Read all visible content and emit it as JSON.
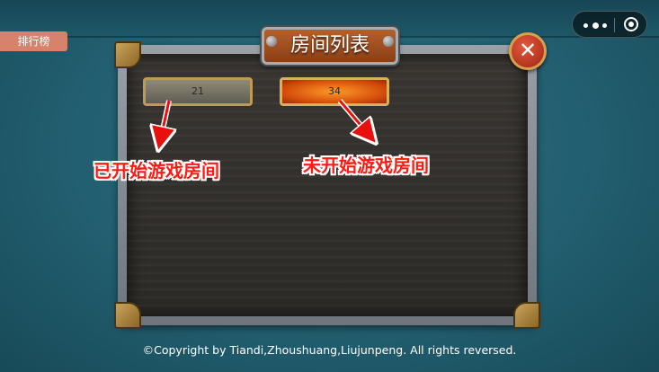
{
  "sidebar": {
    "rank_tab": "排行榜"
  },
  "panel": {
    "title": "房间列表"
  },
  "rooms": [
    {
      "number": "21",
      "state": "started"
    },
    {
      "number": "34",
      "state": "open"
    }
  ],
  "annotations": {
    "started_label": "已开始游戏房间",
    "open_label": "未开始游戏房间"
  },
  "footer": {
    "copyright": "©Copyright  by Tiandi,Zhoushuang,Liujunpeng. All rights reversed."
  },
  "icons": {
    "close": "close-icon",
    "more": "more-icon",
    "target": "target-icon"
  },
  "colors": {
    "annotation": "#ff1a12",
    "open_room": "#e86a10",
    "started_room": "#7a7668",
    "tab": "#d7826b"
  }
}
